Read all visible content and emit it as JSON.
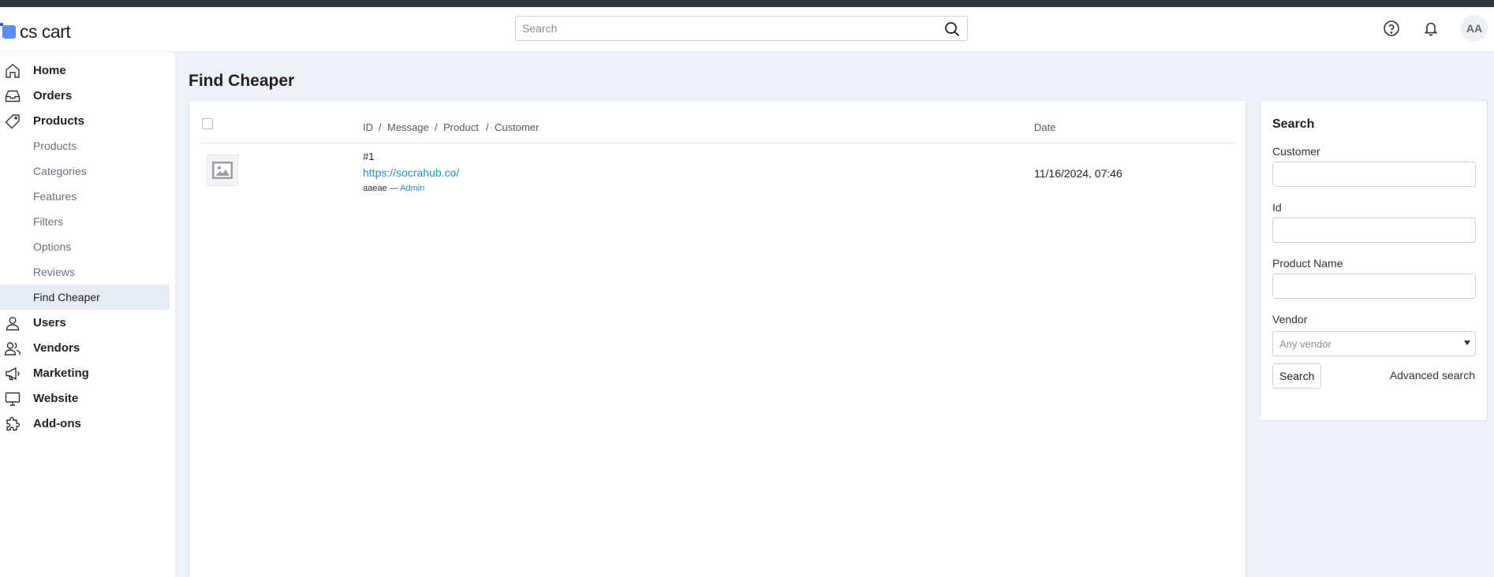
{
  "app": {
    "logo_text": "cs cart"
  },
  "header": {
    "search_placeholder": "Search",
    "help_icon": "help-circle-icon",
    "notifications_icon": "bell-icon",
    "avatar_initials": "AA"
  },
  "sidebar": {
    "items": [
      {
        "label": "Home",
        "icon": "home-icon"
      },
      {
        "label": "Orders",
        "icon": "inbox-icon"
      },
      {
        "label": "Products",
        "icon": "tag-icon"
      },
      {
        "label": "Users",
        "icon": "user-icon"
      },
      {
        "label": "Vendors",
        "icon": "users-icon"
      },
      {
        "label": "Marketing",
        "icon": "megaphone-icon"
      },
      {
        "label": "Website",
        "icon": "monitor-icon"
      },
      {
        "label": "Add-ons",
        "icon": "puzzle-icon"
      }
    ],
    "product_subitems": [
      "Products",
      "Categories",
      "Features",
      "Filters",
      "Options",
      "Reviews",
      "Find Cheaper"
    ],
    "active_subitem": "Find Cheaper"
  },
  "page": {
    "title": "Find Cheaper"
  },
  "table": {
    "headers": {
      "id": "ID",
      "sep1": "/",
      "message": "Message",
      "sep2": "/",
      "product": "Product",
      "sep3": "/",
      "customer": "Customer",
      "date": "Date"
    },
    "rows": [
      {
        "id": "#1",
        "link": "https://socrahub.co/",
        "product": "aaeae",
        "separator": "—",
        "customer": "Admin",
        "date": "11/16/2024, 07:46"
      }
    ]
  },
  "search_panel": {
    "title": "Search",
    "customer_label": "Customer",
    "id_label": "Id",
    "product_name_label": "Product Name",
    "vendor_label": "Vendor",
    "vendor_placeholder": "Any vendor",
    "search_button": "Search",
    "advanced_search": "Advanced search"
  },
  "colors": {
    "accent": "#5b8def",
    "link": "#2b8cc7",
    "active_bg": "#e6ecf5",
    "page_bg": "#eef2f8"
  }
}
